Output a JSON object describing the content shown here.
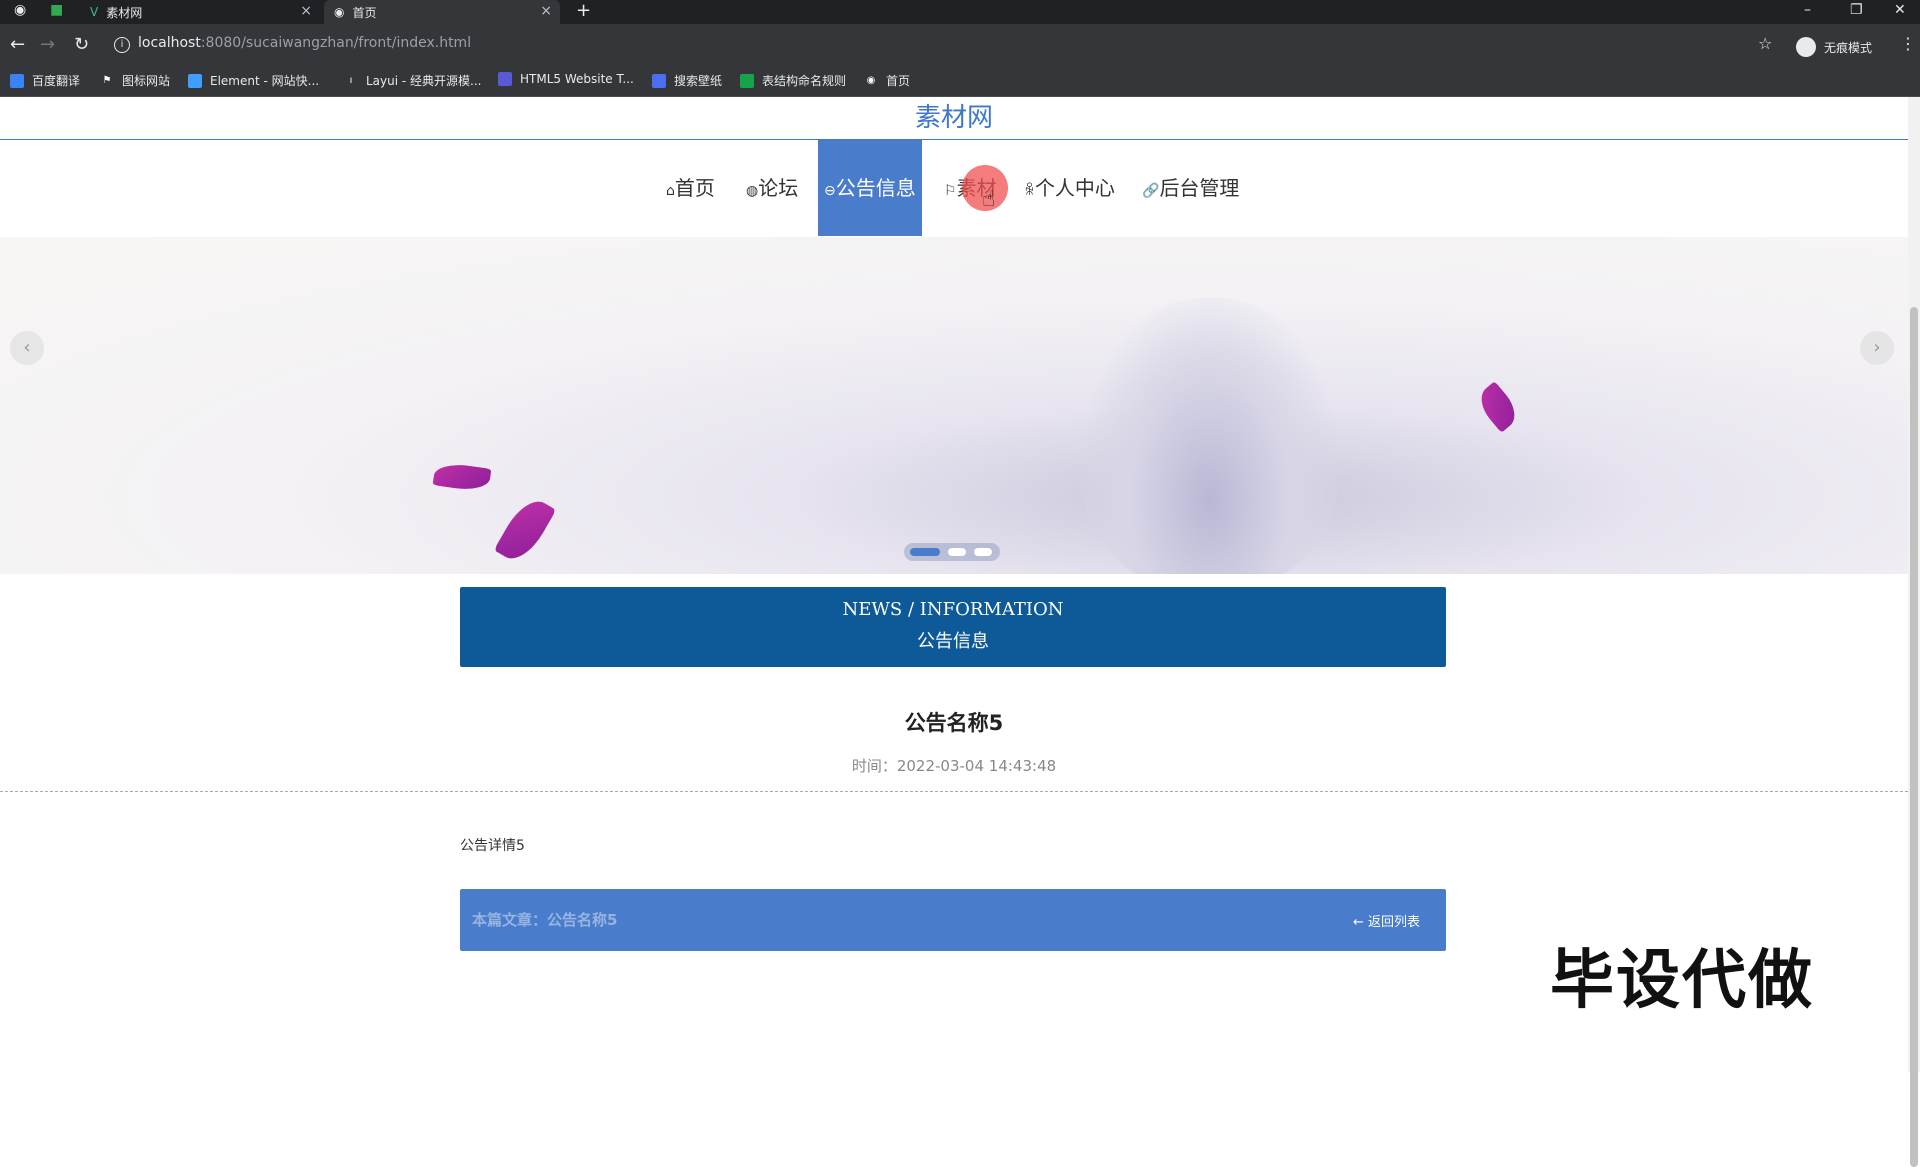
{
  "browser": {
    "tabs": [
      {
        "label": "素材网",
        "close": "×"
      },
      {
        "label": "首页",
        "close": "×"
      }
    ],
    "new_tab": "+",
    "url_host": "localhost",
    "url_rest": ":8080/sucaiwangzhan/front/index.html",
    "incognito_label": "无痕模式",
    "bookmarks": [
      {
        "label": "百度翻译",
        "color": "#3b82f6"
      },
      {
        "label": "图标网站",
        "color": "#ffffff"
      },
      {
        "label": "Element - 网站快...",
        "color": "#409eff"
      },
      {
        "label": "Layui - 经典开源模...",
        "color": "#dddddd"
      },
      {
        "label": "HTML5 Website T...",
        "color": "#5a5ad6"
      },
      {
        "label": "搜索壁纸",
        "color": "#4c6ef5"
      },
      {
        "label": "表结构命名规则",
        "color": "#16a34a"
      },
      {
        "label": "首页",
        "color": "#ffffff"
      }
    ]
  },
  "site": {
    "title": "素材网",
    "nav": [
      {
        "icon": "⌂",
        "label": "首页"
      },
      {
        "icon": "◍",
        "label": "论坛"
      },
      {
        "icon": "⊖",
        "label": "公告信息",
        "active": true
      },
      {
        "icon": "⚐",
        "label": "素材"
      },
      {
        "icon": "ꆜ",
        "label": "个人中心"
      },
      {
        "icon": "🔗",
        "label": "后台管理"
      }
    ],
    "carousel": {
      "prev": "‹",
      "next": "›"
    },
    "section_en": "NEWS / INFORMATION",
    "section_cn": "公告信息",
    "article": {
      "title": "公告名称5",
      "time": "时间：2022-03-04 14:43:48",
      "body": "公告详情5",
      "this_article": "本篇文章：公告名称5",
      "back": "← 返回列表"
    },
    "watermark": "毕设代做"
  }
}
